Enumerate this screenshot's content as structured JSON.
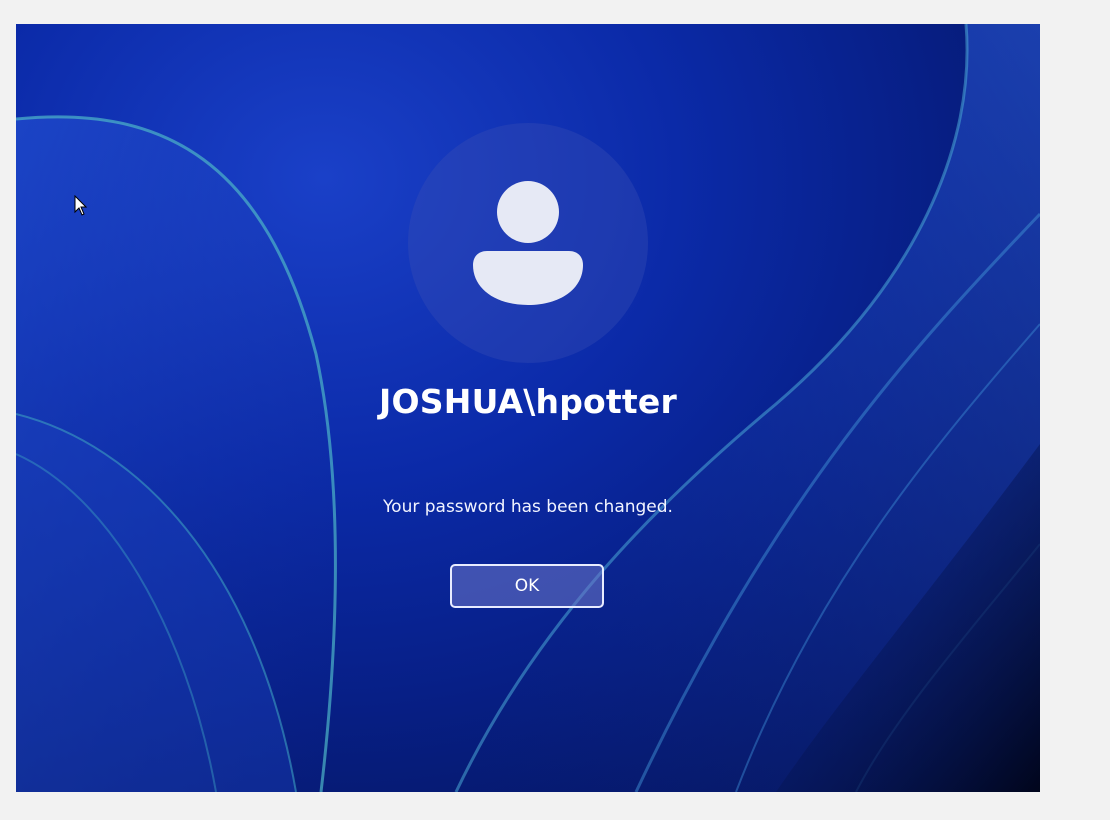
{
  "lock_screen": {
    "username": "JOSHUA\\hpotter",
    "message": "Your password has been changed.",
    "ok_label": "OK",
    "avatar_icon": "user-silhouette-icon",
    "cursor_icon": "mouse-pointer-icon"
  },
  "colors": {
    "background_outer": "#f2f2f2",
    "wallpaper_primary": "#0b2aa8",
    "wallpaper_dark": "#04104a",
    "text": "#ffffff",
    "avatar_silhouette": "#e6e9f5"
  }
}
